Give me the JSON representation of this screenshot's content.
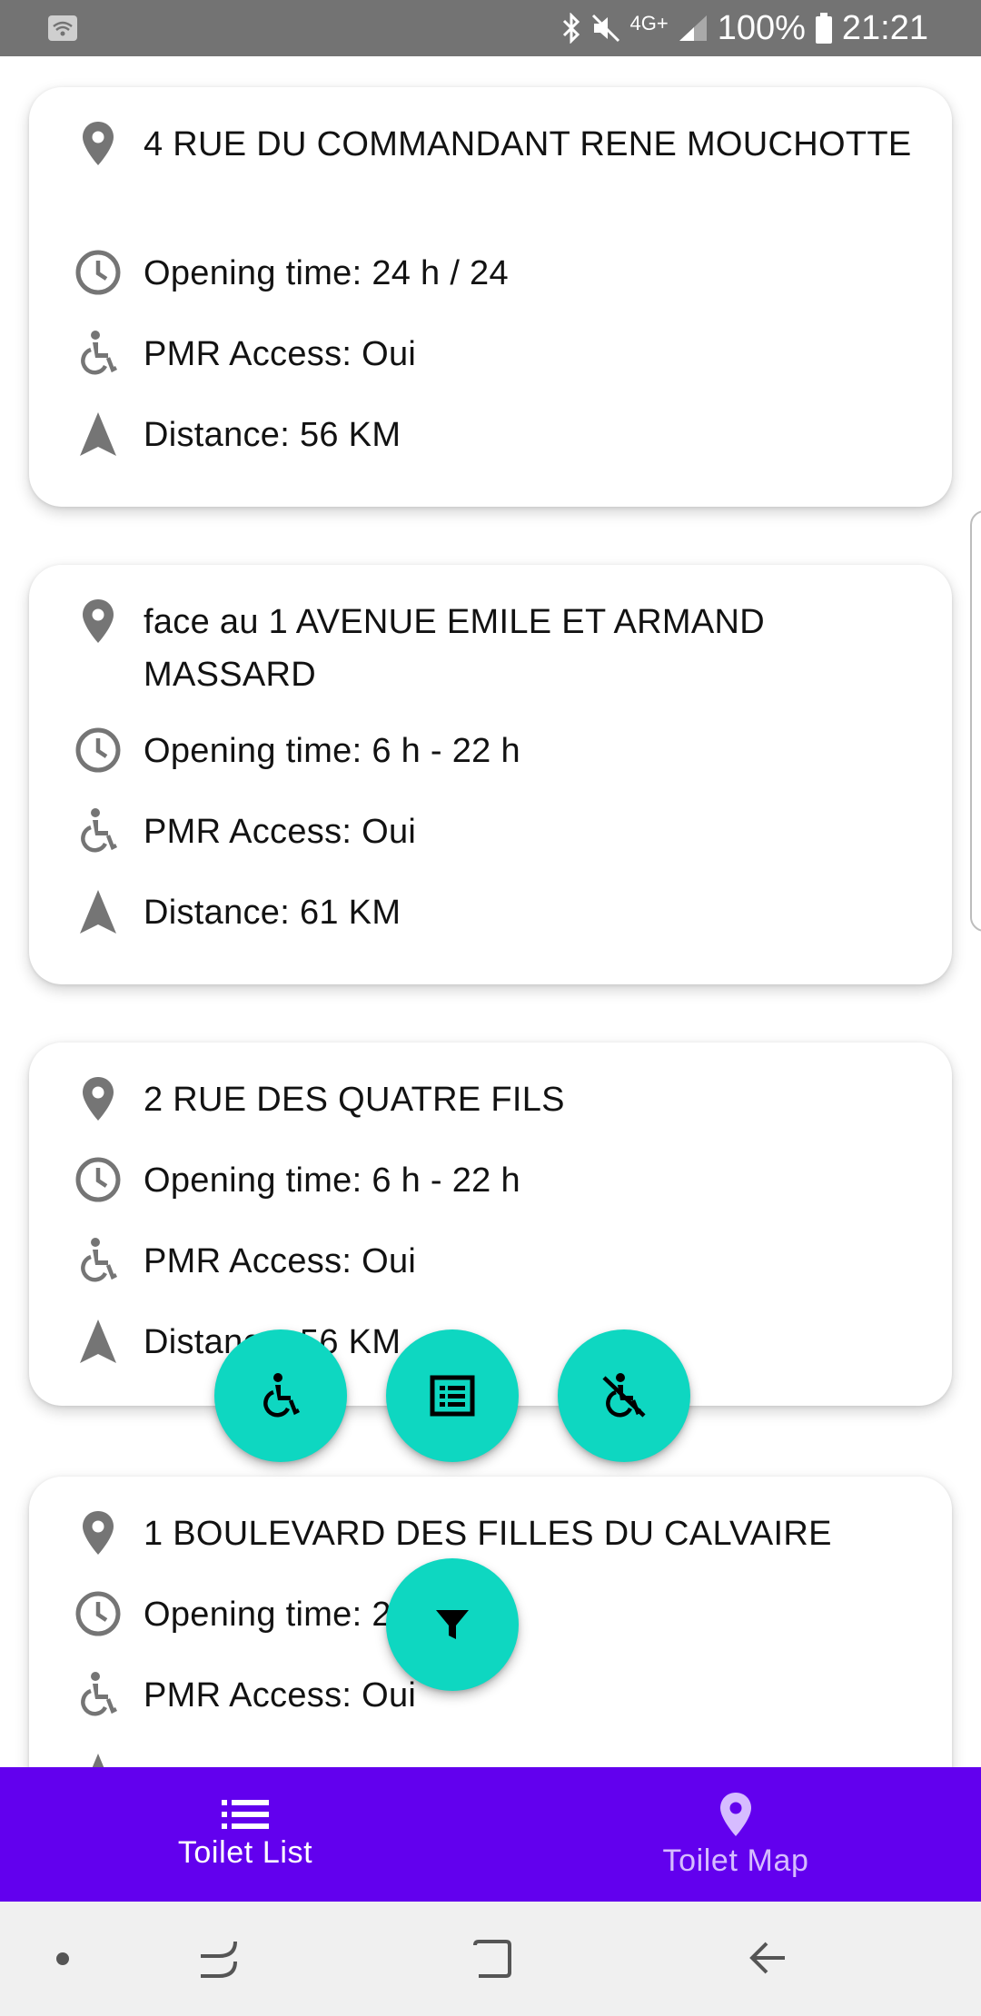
{
  "status_bar": {
    "network": "4G+",
    "battery": "100%",
    "time": "21:21"
  },
  "toilets": [
    {
      "address": "4  RUE DU COMMANDANT RENE MOUCHOTTE",
      "opening": "Opening time: 24 h / 24",
      "pmr": "PMR Access: Oui",
      "distance": "Distance: 56 KM"
    },
    {
      "address": "face au 1 AVENUE EMILE ET ARMAND MASSARD",
      "opening": "Opening time: 6 h - 22 h",
      "pmr": "PMR Access: Oui",
      "distance": "Distance: 61 KM"
    },
    {
      "address": "2  RUE DES QUATRE FILS",
      "opening": "Opening time: 6 h - 22 h",
      "pmr": "PMR Access: Oui",
      "distance": "Distance: 56 KM"
    },
    {
      "address": "1  BOULEVARD DES FILLES DU CALVAIRE",
      "opening": "Opening time: 24 h / 24",
      "pmr": "PMR Access: Oui"
    }
  ],
  "fabs": {
    "pmr_filter_icon": "wheelchair-icon",
    "all_filter_icon": "list-alt-icon",
    "no_pmr_filter_icon": "no-wheelchair-icon",
    "filter_menu_icon": "funnel-icon"
  },
  "bottom_nav": {
    "items": [
      {
        "label": "Toilet List",
        "icon": "list-icon",
        "active": true
      },
      {
        "label": "Toilet Map",
        "icon": "map-pin-icon",
        "active": false
      }
    ]
  },
  "colors": {
    "accent_fab": "#0ed7c1",
    "nav_bar": "#6200ee",
    "icon_grey": "#757575"
  }
}
